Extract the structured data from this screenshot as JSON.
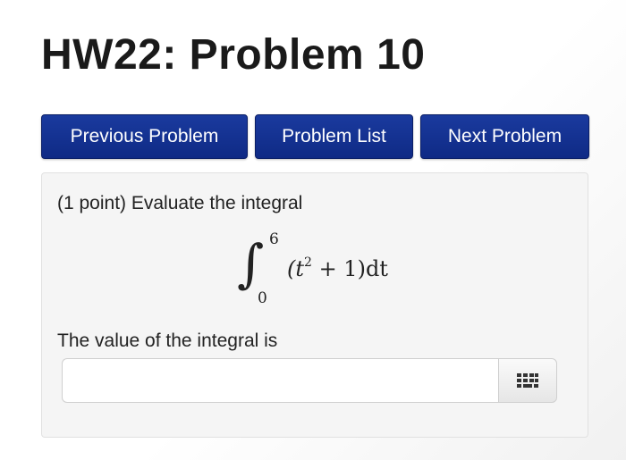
{
  "page": {
    "title": "HW22: Problem 10"
  },
  "nav": {
    "previous_label": "Previous Problem",
    "list_label": "Problem List",
    "next_label": "Next Problem",
    "button_color": "#13338f"
  },
  "problem": {
    "prompt": "(1 point) Evaluate the integral",
    "integral": {
      "upper_limit": "6",
      "lower_limit": "0",
      "integrand_open": "(t",
      "exponent": "2",
      "integrand_rest": " + 1)dt"
    },
    "answer_label": "The value of the integral is",
    "answer_value": "",
    "keyboard_icon": "keyboard-grid-icon"
  }
}
